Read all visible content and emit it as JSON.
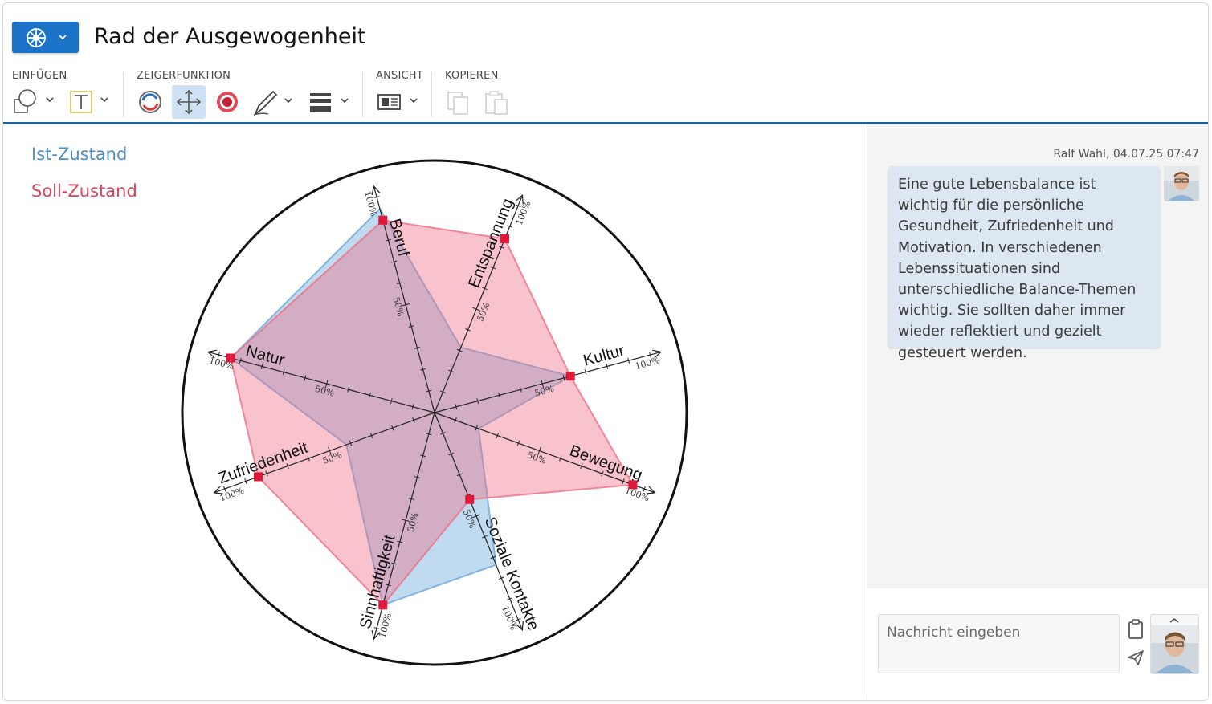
{
  "header": {
    "title": "Rad der Ausgewogenheit",
    "app_menu_icon": "wheel-icon"
  },
  "toolbar": {
    "groups": {
      "insert": "EINFÜGEN",
      "pointer": "ZEIGERFUNKTION",
      "view": "ANSICHT",
      "copy": "KOPIEREN"
    },
    "tools": [
      "shapes-icon",
      "text-icon",
      "rotate-icon",
      "move-icon",
      "target-icon",
      "pen-icon",
      "line-weight-icon",
      "view-icon",
      "copy-icon",
      "paste-icon"
    ],
    "active_tool": "move-icon"
  },
  "legend": {
    "ist": "Ist-Zustand",
    "soll": "Soll-Zustand"
  },
  "chart_data": {
    "type": "radar",
    "axes": [
      "Beruf",
      "Entspannung",
      "Kultur",
      "Bewegung",
      "Soziale Kontakte",
      "Sinnhaftigkeit",
      "Zufriedenheit",
      "Natur"
    ],
    "scale_labels": {
      "mid": "50%",
      "max": "100%"
    },
    "range": [
      0,
      100
    ],
    "series": [
      {
        "name": "Ist-Zustand",
        "color": "#6aa6d8",
        "values": [
          90,
          30,
          60,
          20,
          70,
          85,
          40,
          90
        ]
      },
      {
        "name": "Soll-Zustand",
        "color": "#ee6f86",
        "values": [
          85,
          80,
          60,
          90,
          40,
          85,
          80,
          90
        ]
      }
    ]
  },
  "chat": {
    "author_time": "Ralf Wahl, 04.07.25 07:47",
    "message": "Eine gute Lebensbalance ist wichtig für die persönliche Gesundheit, Zufriedenheit und Motivation. In verschiedenen Lebenssituationen sind unterschiedliche Balance-Themen wichtig. Sie sollten daher immer wieder reflektiert und gezielt gesteuert werden.",
    "input_placeholder": "Nachricht eingeben"
  }
}
